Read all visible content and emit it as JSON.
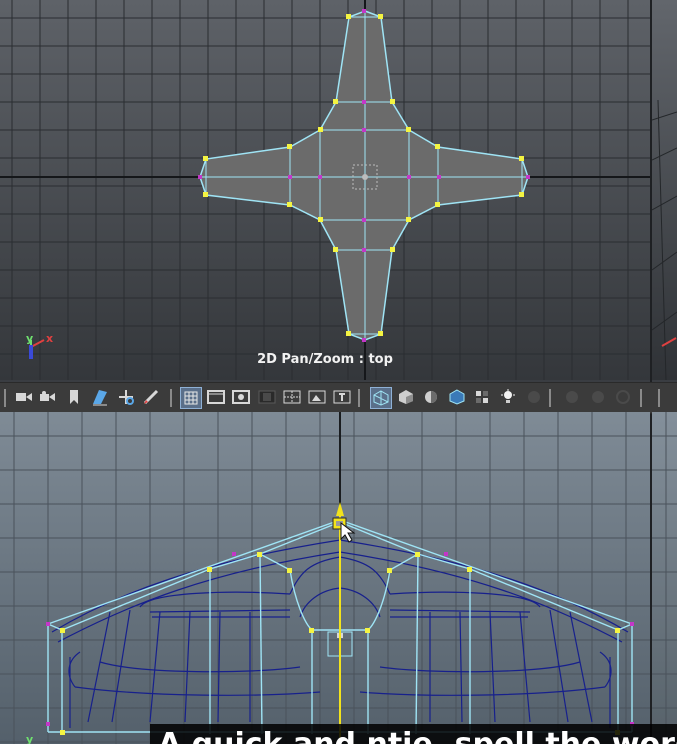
{
  "viewport_top": {
    "label": "2D Pan/Zoom : top",
    "axis_labels": {
      "y": "y",
      "x": "x"
    }
  },
  "viewport_front": {
    "axis_labels": {
      "y": "y"
    }
  },
  "toolbar": {
    "icons": [
      "camera-icon",
      "camera-attributes-icon",
      "bookmark-icon",
      "image-plane-icon",
      "2d-pan-zoom-icon",
      "grease-pencil-icon",
      "grid-icon",
      "film-gate-icon",
      "resolution-gate-icon",
      "gate-mask-icon",
      "field-chart-icon",
      "safe-action-icon",
      "safe-title-icon",
      "wireframe-icon",
      "smooth-shade-icon",
      "default-material-icon",
      "textured-icon",
      "use-all-lights-icon",
      "shadows-icon",
      "screen-space-ao-icon",
      "motion-blur-icon",
      "anti-aliasing-icon",
      "depth-of-field-icon"
    ]
  },
  "colors": {
    "wire_top": "#9fe4f5",
    "vertex_yellow": "#f4f442",
    "vertex_magenta": "#c436c8",
    "wire_dark_blue": "#17208c",
    "manipulator_yellow": "#f2e31c"
  },
  "caption": {
    "text": "A quick and ntie. spell the words"
  }
}
